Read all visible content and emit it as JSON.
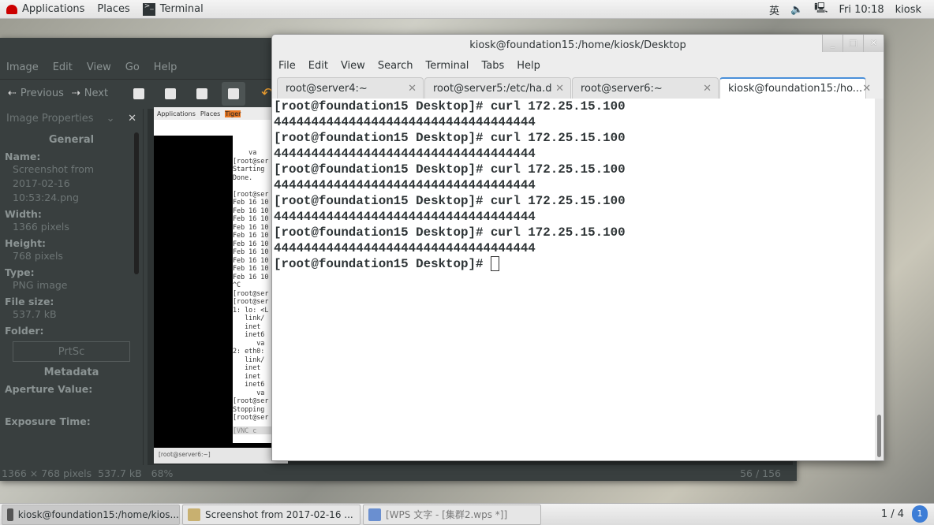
{
  "topbar": {
    "applications": "Applications",
    "places": "Places",
    "active_app": "Terminal",
    "input_method": "英",
    "volume_icon": "volume-muted-icon",
    "network_icon": "network-offline-icon",
    "clock": "Fri 10:18",
    "user": "kiosk"
  },
  "viewer": {
    "menu": [
      "Image",
      "Edit",
      "View",
      "Go",
      "Help"
    ],
    "previous": "Previous",
    "next": "Next",
    "sidebar": {
      "title": "Image Properties",
      "general": "General",
      "fields": [
        {
          "label": "Name:",
          "value": "Screenshot from 2017-02-16 10:53:24.png"
        },
        {
          "label": "Width:",
          "value": "1366 pixels"
        },
        {
          "label": "Height:",
          "value": "768 pixels"
        },
        {
          "label": "Type:",
          "value": "PNG image"
        },
        {
          "label": "File size:",
          "value": "537.7 kB"
        },
        {
          "label": "Folder:",
          "value": "PrtSc"
        }
      ],
      "metadata": "Metadata",
      "meta_fields": [
        "Aperture Value:",
        "Exposure Time:"
      ]
    },
    "status": {
      "dimensions": "1366 × 768 pixels",
      "size": "537.7 kB",
      "zoom": "68%",
      "position": "56 / 156"
    },
    "inner_screenshot": {
      "applications": "Applications",
      "places": "Places",
      "app": "Tiger",
      "lines": [
        "    va",
        "[root@ser",
        "Starting",
        "Done.",
        "",
        "[root@ser",
        "Feb 16 10",
        "Feb 16 10",
        "Feb 16 10",
        "Feb 16 10",
        "Feb 16 10",
        "Feb 16 10",
        "Feb 16 10",
        "Feb 16 10",
        "Feb 16 10",
        "Feb 16 10",
        "^C",
        "[root@ser",
        "[root@ser",
        "1: lo: <L",
        "   link/",
        "   inet",
        "   inet6",
        "      va",
        "2: eth0:",
        "   link/",
        "   inet",
        "   inet",
        "   inet6",
        "      va",
        "[root@ser",
        "Stopping",
        "[root@ser"
      ],
      "vnc": "[VNC c",
      "taskbar": "[root@server6:~]"
    }
  },
  "terminal": {
    "title": "kiosk@foundation15:/home/kiosk/Desktop",
    "menu": [
      "File",
      "Edit",
      "View",
      "Search",
      "Terminal",
      "Tabs",
      "Help"
    ],
    "tabs": [
      {
        "label": "root@server4:~",
        "active": false
      },
      {
        "label": "root@server5:/etc/ha.d",
        "active": false
      },
      {
        "label": "root@server6:~",
        "active": false
      },
      {
        "label": "kiosk@foundation15:/ho...",
        "active": true
      }
    ],
    "lines": [
      "[root@foundation15 Desktop]# curl 172.25.15.100",
      "44444444444444444444444444444444444",
      "[root@foundation15 Desktop]# curl 172.25.15.100",
      "44444444444444444444444444444444444",
      "[root@foundation15 Desktop]# curl 172.25.15.100",
      "44444444444444444444444444444444444",
      "[root@foundation15 Desktop]# curl 172.25.15.100",
      "44444444444444444444444444444444444",
      "[root@foundation15 Desktop]# curl 172.25.15.100",
      "44444444444444444444444444444444444"
    ],
    "prompt": "[root@foundation15 Desktop]# "
  },
  "taskbar": {
    "tasks": [
      {
        "label": "kiosk@foundation15:/home/kios...",
        "active": true
      },
      {
        "label": "Screenshot from 2017-02-16 ...",
        "active": false
      },
      {
        "label": "[WPS 文字 - [集群2.wps *]]",
        "active": false
      }
    ],
    "workspace": "1 / 4",
    "notifications": "1"
  }
}
